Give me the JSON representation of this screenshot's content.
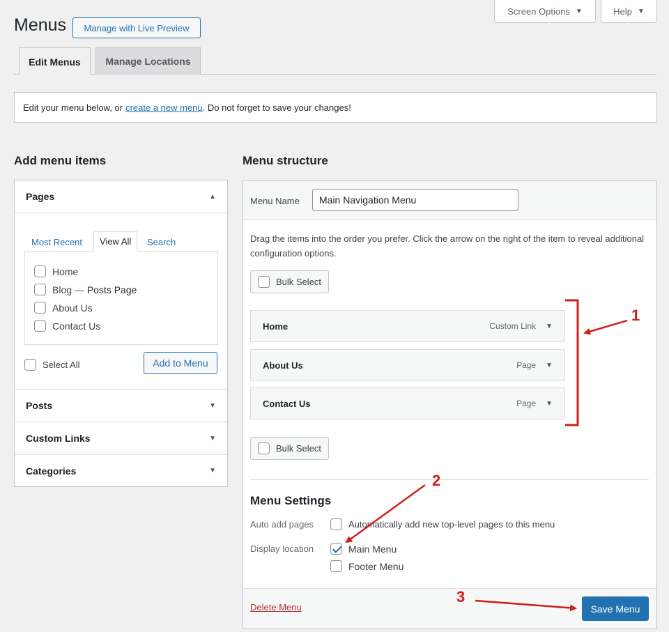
{
  "top": {
    "screen_options_label": "Screen Options",
    "help_label": "Help"
  },
  "header": {
    "title": "Menus",
    "live_preview_label": "Manage with Live Preview"
  },
  "tabs": [
    {
      "label": "Edit Menus",
      "active": true
    },
    {
      "label": "Manage Locations",
      "active": false
    }
  ],
  "notice": {
    "before": "Edit your menu below, or",
    "link": "create a new menu",
    "after": ". Do not forget to save your changes!"
  },
  "add_items": {
    "heading": "Add menu items",
    "pages": {
      "title": "Pages",
      "tabs": [
        "Most Recent",
        "View All",
        "Search"
      ],
      "active_tab": "View All",
      "items": [
        {
          "label": "Home",
          "suffix": ""
        },
        {
          "label": "Blog — ",
          "suffix": "Posts Page"
        },
        {
          "label": "About Us",
          "suffix": ""
        },
        {
          "label": "Contact Us",
          "suffix": ""
        }
      ],
      "select_all_label": "Select All",
      "add_button_label": "Add to Menu"
    },
    "sections": [
      "Posts",
      "Custom Links",
      "Categories"
    ]
  },
  "menu_structure": {
    "heading": "Menu structure",
    "menu_name_label": "Menu Name",
    "menu_name_value": "Main Navigation Menu",
    "instructions": "Drag the items into the order you prefer. Click the arrow on the right of the item to reveal additional configuration options.",
    "bulk_select_label": "Bulk Select",
    "items": [
      {
        "title": "Home",
        "type": "Custom Link"
      },
      {
        "title": "About Us",
        "type": "Page"
      },
      {
        "title": "Contact Us",
        "type": "Page"
      }
    ],
    "settings": {
      "heading": "Menu Settings",
      "auto_add_label": "Auto add pages",
      "auto_add_option": "Automatically add new top-level pages to this menu",
      "auto_add_checked": false,
      "display_location_label": "Display location",
      "locations": [
        {
          "label": "Main Menu",
          "checked": true
        },
        {
          "label": "Footer Menu",
          "checked": false
        }
      ]
    },
    "delete_label": "Delete Menu",
    "save_label": "Save Menu"
  },
  "annotations": [
    "1",
    "2",
    "3"
  ],
  "colors": {
    "accent": "#2271b1",
    "annotation_red": "#d0201a",
    "delete_red": "#b32d2e"
  }
}
